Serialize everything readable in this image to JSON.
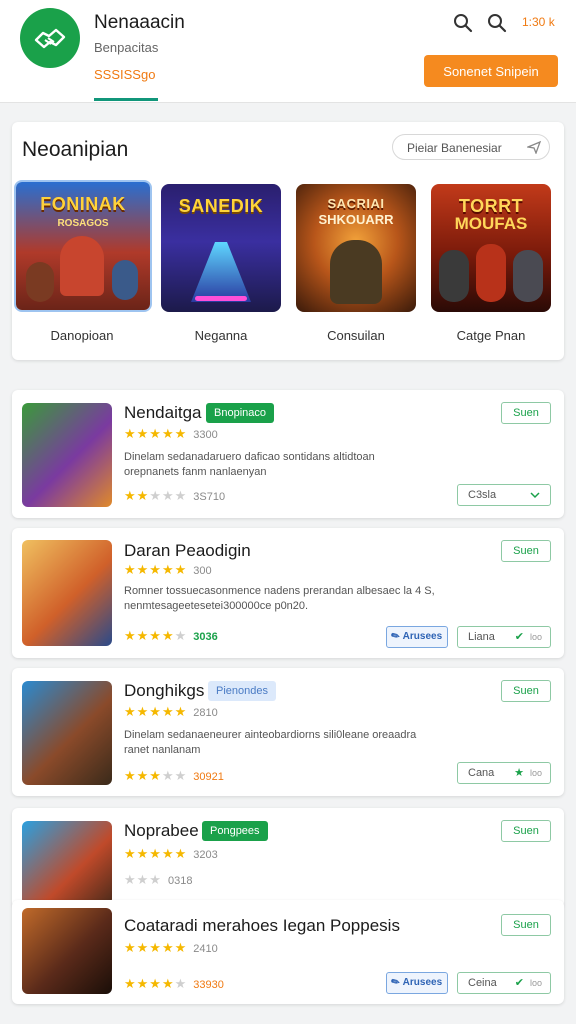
{
  "header": {
    "title": "Nenaaacin",
    "subtitle": "Benpacitas",
    "meta": "SSSISSgo",
    "count": "1:30 k",
    "cta_label": "Sonenet Snipein"
  },
  "featured": {
    "title": "Neoanipian",
    "search_placeholder": "Pieiar Banenesiar",
    "tiles": [
      {
        "banner": "FONINAK",
        "sub": "ROSAGOS",
        "label": "Danopioan"
      },
      {
        "banner": "SANEDIK",
        "sub": "",
        "label": "Neganna"
      },
      {
        "banner": "SACRIAI",
        "sub": "SHKOUARR",
        "label": "Consuilan"
      },
      {
        "banner": "TORRT",
        "sub": "MOUFAS",
        "label": "Catge Pnan"
      }
    ]
  },
  "cards": [
    {
      "title": "Nendaitga",
      "badge": "Bnopinaco",
      "rating_count": "3300",
      "desc": "Dinelam sedanadaruero daficao sontidans altidtoan orepnanets fanm nanlaenyan",
      "rating2_count": "3S710",
      "select_label": "C3sla",
      "button": "Suen"
    },
    {
      "title": "Daran Peaodigin",
      "rating_count": "300",
      "desc": "Romner tossuecasonmence nadens prerandan albesaec la 4 S, nenmtesageetesetei300000ce p0n20.",
      "rating2_count": "3036",
      "blue_label": "Arusees",
      "chip_label": "Liana",
      "chip_small": "loo",
      "button": "Suen"
    },
    {
      "title": "Donghikgs",
      "badge": "Pienondes",
      "rating_count": "2810",
      "desc": "Dinelam sedanaeneurer ainteobardiorns sili0leane oreaadra ranet nanlanam",
      "rating2_count": "30921",
      "chip_label": "Cana",
      "chip_small": "loo",
      "button": "Suen"
    },
    {
      "title": "Noprabee",
      "badge": "Pongpees",
      "rating_count": "3203",
      "rating2_count": "0318",
      "button": "Suen"
    },
    {
      "title": "Coataradi merahoes Iegan Poppesis",
      "rating_count": "2410",
      "rating2_count": "33930",
      "blue_label": "Arusees",
      "chip_label": "Ceina",
      "chip_small": "loo",
      "button": "Suen"
    }
  ],
  "colors": {
    "brand_green": "#1aa14a",
    "accent_orange": "#f58a1f",
    "star_yellow": "#f5b800"
  }
}
